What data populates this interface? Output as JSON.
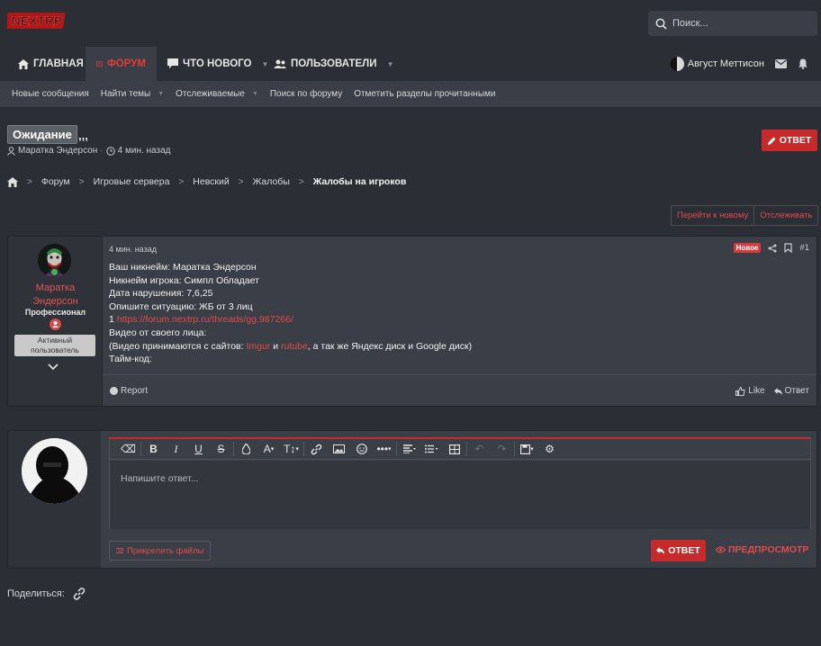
{
  "header": {
    "logo_text": "NEXTRP",
    "search_placeholder": "Поиск..."
  },
  "nav": {
    "tabs": [
      {
        "label": "ГЛАВНАЯ",
        "icon": "home-icon"
      },
      {
        "label": "ФОРУМ",
        "icon": "forum-icon",
        "active": true
      },
      {
        "label": "ЧТО НОВОГО",
        "icon": "comment-icon"
      },
      {
        "label": "ПОЛЬЗОВАТЕЛИ",
        "icon": "users-icon"
      }
    ],
    "user_name": "Август Меттисон"
  },
  "subnav": {
    "items": [
      "Новые сообщения",
      "Найти темы",
      "Отслеживаемые",
      "Поиск по форуму",
      "Отметить разделы прочитанными"
    ]
  },
  "thread": {
    "prefix": "Ожидание",
    "title": ",,,",
    "author": "Маратка Эндерсон",
    "time": "4 мин. назад",
    "reply_label": "ОТВЕТ"
  },
  "breadcrumbs": [
    "Форум",
    "Игровые сервера",
    "Невский",
    "Жалобы",
    "Жалобы на игроков"
  ],
  "thread_actions": {
    "goto_new": "Перейти к новому",
    "watch": "Отслеживать"
  },
  "post": {
    "user": {
      "name_line1": "Маратка",
      "name_line2": "Эндерсон",
      "role": "Профессионал",
      "status_line1": "Активный",
      "status_line2": "пользователь"
    },
    "time": "4 мин. назад",
    "badge": "Новое",
    "number": "#1",
    "lines": {
      "l1": "Ваш никнейм: Маратка Эндерсон",
      "l2": "Никнейм игрока: Симпл Обладает",
      "l3": "Дата нарушения: 7,6,25",
      "l4": "Опишите ситуацию: ЖБ от 3 лиц",
      "l5_prefix": "1 ",
      "l5_link": "https://forum.nextrp.ru/threads/gg.987266/",
      "l6": "Видео от своего лица:",
      "l7_a": "(Видео принимаются с сайтов: ",
      "l7_imgur": "Imgur",
      "l7_b": " и ",
      "l7_rutube": "rutube",
      "l7_c": ", а так же Яндекс диск и Google диск)",
      "l8": "Тайм-код:"
    },
    "report": "Report",
    "like": "Like",
    "reply": "Ответ"
  },
  "reply_form": {
    "placeholder": "Напишите ответ...",
    "attach": "Прикрепить файлы",
    "submit": "ОТВЕТ",
    "preview": "ПРЕДПРОСМОТР"
  },
  "share": {
    "label": "Поделиться:"
  },
  "colors": {
    "accent": "#c62a2a",
    "link": "#e04a4a",
    "background": "#2b2e34",
    "panel": "#3a3e46"
  }
}
